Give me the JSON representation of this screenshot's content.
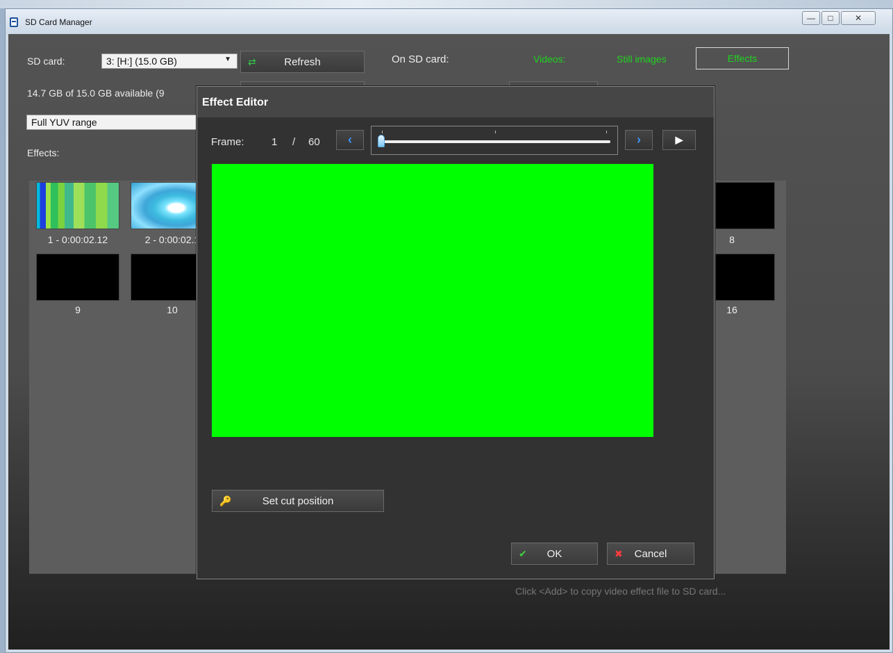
{
  "window": {
    "title": "SD Card Manager",
    "controls": [
      "—",
      "□",
      "✕"
    ]
  },
  "toolbar": {
    "sd_card_label": "SD card:",
    "sd_card_value": "3: [H:] (15.0 GB)",
    "refresh_label": "Refresh",
    "on_sd_label": "On SD card:",
    "videos_tab": "Videos:",
    "still_images_tab": "Still images",
    "effects_tab": "Effects"
  },
  "status": {
    "available": "14.7 GB of 15.0 GB available (9"
  },
  "range_select": {
    "value": "Full YUV range"
  },
  "effects": {
    "label": "Effects:",
    "row1_captions": [
      "1 - 0:00:02.12",
      "2 - 0:00:02.1",
      "8"
    ],
    "row2_captions": [
      "9",
      "10",
      "16"
    ]
  },
  "hint": "Click <Add> to copy video effect file to SD card...",
  "dialog": {
    "title": "Effect Editor",
    "frame_label": "Frame:",
    "frame_current": "1",
    "frame_sep": "/",
    "frame_total": "60",
    "current_frame_fraction": 0,
    "prev_icon": "‹",
    "next_icon": "›",
    "play_icon": "▶",
    "set_cut_label": "Set cut position",
    "ok_label": "OK",
    "cancel_label": "Cancel",
    "preview_color": "#00ff00"
  },
  "colors": {
    "accent_green": "#1fd41f",
    "nav_blue": "#3c95ff"
  }
}
